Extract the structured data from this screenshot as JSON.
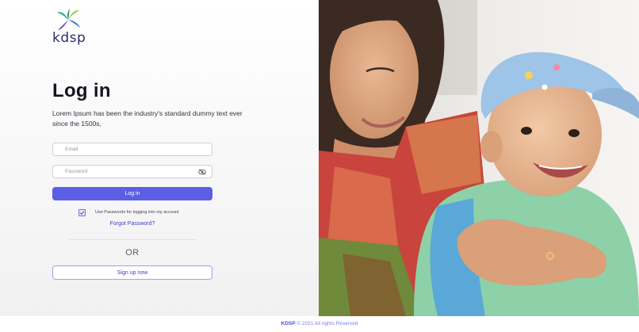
{
  "brand": {
    "logo_text": "kdsp",
    "accent": "#5b5fe4"
  },
  "login": {
    "title": "Log in",
    "subtitle": "Lorem Ipsum has been the industry's standard dummy text ever since the 1500s,",
    "email_placeholder": "Email",
    "password_placeholder": "Password",
    "password_toggle_icon": "eye-slash-icon",
    "login_label": "Log in",
    "remember_label": "Use Passwords for logging into my account",
    "remember_checked": true,
    "forgot_label": "Forgot Password?",
    "or_label": "OR",
    "signup_label": "Sign up now"
  },
  "hero": {
    "image_subject": "mother-holding-baby-photo"
  },
  "footer": {
    "brand": "KDSP",
    "text": "© 2021 All rights Reserved"
  }
}
